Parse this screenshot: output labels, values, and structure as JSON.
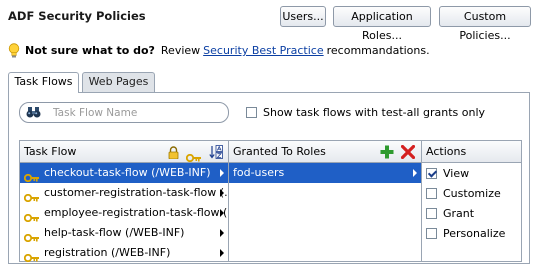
{
  "header": {
    "title": "ADF Security Policies",
    "buttons": [
      "Users...",
      "Application Roles...",
      "Custom Policies..."
    ]
  },
  "hint": {
    "prefix": "Not sure what to do?",
    "text_before": "Review",
    "link": "Security Best Practice",
    "text_after": "recommandations."
  },
  "tabs": [
    "Task Flows",
    "Web Pages"
  ],
  "search": {
    "placeholder": "Task Flow Name",
    "value": ""
  },
  "filter": {
    "label": "Show task flows with test-all grants only",
    "checked": false
  },
  "task_flow_column": {
    "header": "Task Flow",
    "items": [
      "checkout-task-flow (/WEB-INF)",
      "customer-registration-task-flow (....",
      "employee-registration-task-flow (...",
      "help-task-flow (/WEB-INF)",
      "registration (/WEB-INF)"
    ],
    "selected_index": 0
  },
  "roles_column": {
    "header": "Granted To Roles",
    "items": [
      "fod-users"
    ],
    "selected_index": 0
  },
  "actions_column": {
    "header": "Actions",
    "items": [
      {
        "label": "View",
        "checked": true
      },
      {
        "label": "Customize",
        "checked": false
      },
      {
        "label": "Grant",
        "checked": false
      },
      {
        "label": "Personalize",
        "checked": false
      }
    ]
  },
  "colors": {
    "selection": "#1f5fc6",
    "link": "#0b3fa3",
    "key_icon": "#e0b000",
    "add_icon": "#2e9a2e",
    "delete_icon": "#d42020"
  },
  "icons": [
    "lightbulb-icon",
    "binoculars-icon",
    "lock-icon",
    "key-icon",
    "sort-az-icon",
    "add-icon",
    "delete-icon"
  ]
}
